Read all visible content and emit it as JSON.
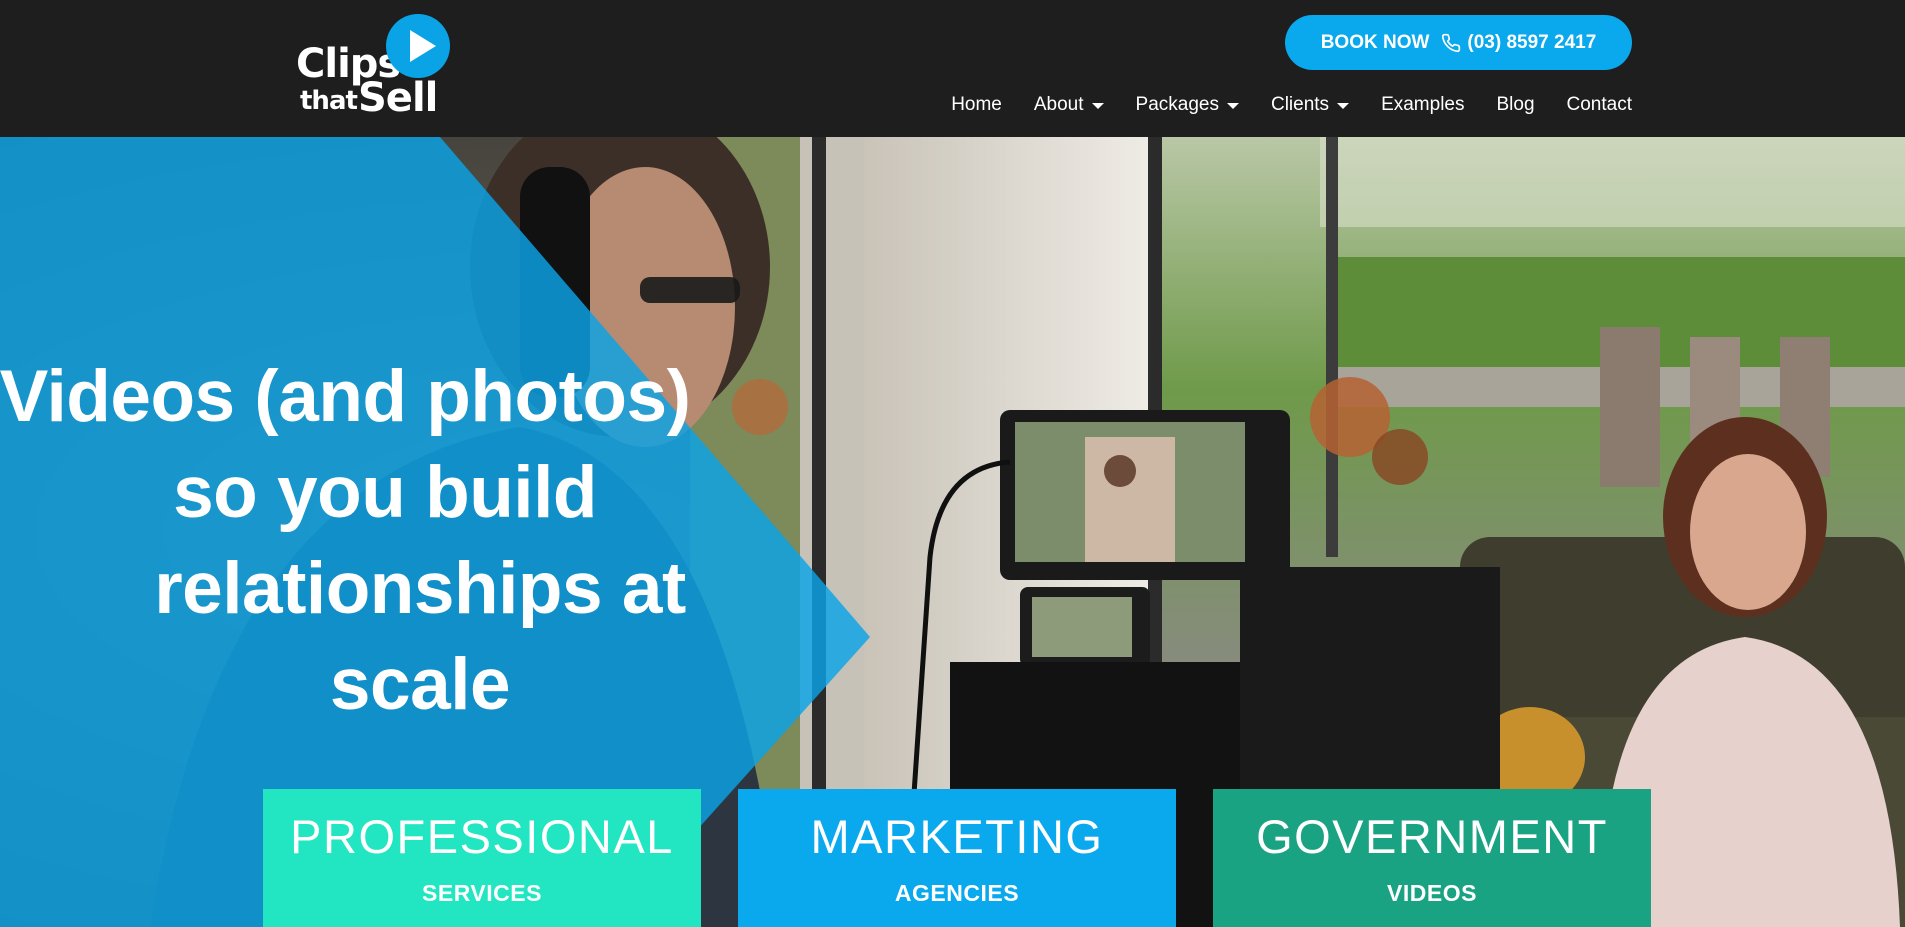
{
  "header": {
    "logo": {
      "line1": "Clips",
      "line2": "that",
      "line3": "Sell"
    },
    "book_button": {
      "label": "BOOK NOW",
      "phone": "(03) 8597 2417",
      "icon": "phone-icon"
    },
    "nav": {
      "items": [
        {
          "label": "Home",
          "has_dropdown": false
        },
        {
          "label": "About",
          "has_dropdown": true
        },
        {
          "label": "Packages",
          "has_dropdown": true
        },
        {
          "label": "Clients",
          "has_dropdown": true
        },
        {
          "label": "Examples",
          "has_dropdown": false
        },
        {
          "label": "Blog",
          "has_dropdown": false
        },
        {
          "label": "Contact",
          "has_dropdown": false
        }
      ]
    }
  },
  "hero": {
    "headline_lines": [
      "Videos (and photos)",
      "so you build",
      "relationships at",
      "scale"
    ],
    "cards": [
      {
        "title": "PROFESSIONAL",
        "subtitle": "SERVICES",
        "color": "#22e6c2"
      },
      {
        "title": "MARKETING",
        "subtitle": "AGENCIES",
        "color": "#0aa8ec"
      },
      {
        "title": "GOVERNMENT",
        "subtitle": "VIDEOS",
        "color": "#1aa383"
      }
    ]
  },
  "colors": {
    "accent": "#0aa8ec",
    "header_bg": "#1e1e1e"
  }
}
